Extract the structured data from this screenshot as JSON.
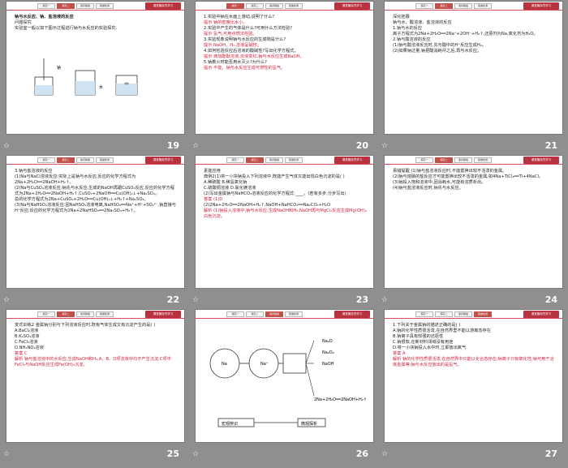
{
  "tabs": [
    "探究一",
    "探究二",
    "素养脉络",
    "随堂检测"
  ],
  "badge": "课堂篇探究学习",
  "slides": [
    {
      "num": "19",
      "active": 1,
      "lines": [
        {
          "t": "钠与水反应、钠、盐溶液的反应",
          "c": "bold"
        },
        {
          "t": "问题探究"
        },
        {
          "t": "实验室一般以如下图示过程进行钠与水反应的实验探究:"
        }
      ],
      "figure": "apparatus",
      "figure_labels": [
        "钠",
        "水"
      ]
    },
    {
      "num": "20",
      "active": 0,
      "lines": [
        {
          "t": "1.实验中钠在水面上游动,说明了什么?"
        },
        {
          "t": "提示 钠的密度比水小。",
          "c": "hint"
        },
        {
          "t": "2.实验中产生的气体是什么?可用什么方法检验?"
        },
        {
          "t": "提示 氢气,可用点燃法检验。",
          "c": "hint"
        },
        {
          "t": "3.实验现象说明钠与水反应的生成物是什么?"
        },
        {
          "t": "提示 NaOH、H₂,溶液呈碱性。",
          "c": "hint"
        },
        {
          "t": "4.如何检验反应后溶液的酸碱性?写出化学方程式。"
        },
        {
          "t": "提示 滴加酚酞溶液,溶液变红,钠与水反应生成NaOH。",
          "c": "hint"
        },
        {
          "t": "5.钠着火时能否用水灭火?为什么?"
        },
        {
          "t": "提示 不能。钠与水反应生成可燃性的氢气。",
          "c": "hint"
        }
      ]
    },
    {
      "num": "21",
      "active": 1,
      "lines": [
        {
          "t": "深化拓展"
        },
        {
          "t": "钠与水、酸溶液、盐溶液的反应"
        },
        {
          "t": "1.钠与水的反应"
        },
        {
          "t": "离子方程式为2Na+2H₂O══2Na⁺+2OH⁻+H₂↑,还原剂为Na,氧化剂为H₂O。"
        },
        {
          "t": "2.钠与酸溶液的反应"
        },
        {
          "t": "(1)钠与酸溶液反应时,先与酸中的H⁺反应生成H₂。"
        },
        {
          "t": "(2)如果钠过量,钠把酸消耗尽之后,再与水反应。"
        }
      ]
    },
    {
      "num": "22",
      "active": 1,
      "lines": [
        {
          "t": "3.钠与盐溶液的反应"
        },
        {
          "t": "(1)Na与NaCl溶液反应:实际上是钠与水反应,反应的化学方程式为2Na+2H₂O══2NaOH+H₂↑。"
        },
        {
          "t": "(2)Na与CuSO₄溶液反应:钠先与水反应,生成的NaOH再跟CuSO₄反应,反应的化学方程式为2Na+2H₂O══2NaOH+H₂↑,CuSO₄+2NaOH══Cu(OH)₂↓+Na₂SO₄。"
        },
        {
          "t": "总的化学方程式为2Na+CuSO₄+2H₂O══Cu(OH)₂↓+H₂↑+Na₂SO₄。"
        },
        {
          "t": "(3)Na与NaHSO₄溶液反应:因NaHSO₄溶液电离,NaHSO₄══Na⁺+H⁺+SO₄²⁻,钠直接与H⁺反应,反应的化学方程式为2Na+2NaHSO₄══2Na₂SO₄+H₂↑。"
        }
      ]
    },
    {
      "num": "23",
      "active": 1,
      "lines": [
        {
          "t": "素能应用"
        },
        {
          "t": "典例2(1)将一小块钠投入下列溶液中,既能产生气体又能出现白色沉淀的是( )"
        },
        {
          "t": "A.稀硫酸        B.稀氢氧化钠"
        },
        {
          "t": "C.硫酸铜溶液   D.氯化镁溶液"
        },
        {
          "t": "(2)写出金属钠与NaHCO₃溶液反应的化学方程式:____。(若有多步,分步写出)"
        },
        {
          "t": "答案 (1)D",
          "c": "hint"
        },
        {
          "t": "(2)2Na+2H₂O══2NaOH+H₂↑,NaOH+NaHCO₃══Na₂CO₃+H₂O"
        },
        {
          "t": "解析 (1)钠投入溶液中,钠与水反应,生成NaOH和H₂,NaOH再与MgCl₂反应生成Mg(OH)₂白色沉淀。",
          "c": "hint"
        }
      ]
    },
    {
      "num": "24",
      "active": 1,
      "lines": [
        {
          "t": "易错提醒 (1)钠与盐溶液反应时,不能置换出较不活泼的金属。"
        },
        {
          "t": "(2)钠与熔融的盐反应才可能置换出较不活泼的金属,如4Na+TiCl₄══Ti+4NaCl。"
        },
        {
          "t": "(3)钠投入饱和溶液中,因消耗水,可能有溶质析出。"
        },
        {
          "t": "(4)钠与盐溶液反应时,钠先与水反应。"
        }
      ]
    },
    {
      "num": "25",
      "active": 1,
      "lines": [
        {
          "t": "变式训练2 金属钠分别与下列溶液反应时,既有气体生成又有沉淀产生的是( )"
        },
        {
          "t": "A.BaCl₂溶液"
        },
        {
          "t": "B.K₂SO₄溶液"
        },
        {
          "t": "C.FeCl₃溶液"
        },
        {
          "t": "D.NH₄NO₃溶液"
        },
        {
          "t": "答案 C",
          "c": "hint"
        },
        {
          "t": "解析 钠与盐溶液中的水反应,生成NaOH和H₂,A、B、D项溶液中均不产生沉淀,C项中FeCl₃与NaOH反应生成Fe(OH)₃沉淀。",
          "c": "hint"
        }
      ]
    },
    {
      "num": "26",
      "active": 2,
      "lines": [],
      "figure": "flowchart",
      "figure_labels": [
        "Na",
        "Na⁺",
        "Na₂O",
        "Na₂O₂",
        "NaOH",
        "2Na+2H₂O══2NaOH+H₂↑",
        "宏观辨识",
        "微观探析"
      ]
    },
    {
      "num": "27",
      "active": 3,
      "lines": [
        {
          "t": "1.下列关于金属钠的描述正确的是( )"
        },
        {
          "t": "A.钠的化学性质很活泼,在自然界里不能以游离态存在"
        },
        {
          "t": "B.钠离子具有较强的还原性"
        },
        {
          "t": "C.钠很软,在新材料领域没有用途"
        },
        {
          "t": "D.将一小块钠投入水中时,立即放出氧气"
        },
        {
          "t": "答案 A",
          "c": "hint"
        },
        {
          "t": "解析 钠的化学性质很活泼,在自然界中只能以化合态存在;钠离子只有氧化性;钠可用于冶炼金属等;钠与水反应放出的是氢气。",
          "c": "hint"
        }
      ]
    }
  ]
}
